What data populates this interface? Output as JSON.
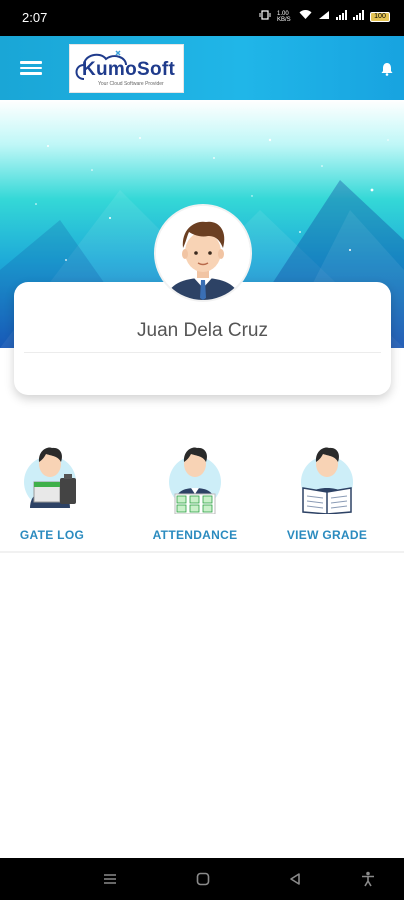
{
  "status_bar": {
    "time": "2:07",
    "network_speed": "1.00 KB/S",
    "battery": "100",
    "icons": [
      "vibrate-icon",
      "wifi-icon",
      "volte-icon",
      "signal-icon",
      "signal-icon",
      "battery-icon"
    ]
  },
  "app_bar": {
    "logo_text": "KumoSoft",
    "logo_tagline": "Your Cloud Software Provider",
    "icons": [
      "menu-icon",
      "bell-icon"
    ],
    "colors": {
      "primary": "#1aa6d6"
    }
  },
  "profile": {
    "name": "Juan Dela Cruz"
  },
  "actions": [
    {
      "label": "GATE LOG",
      "icon": "gate-log-icon"
    },
    {
      "label": "ATTENDANCE",
      "icon": "attendance-icon"
    },
    {
      "label": "VIEW GRADE",
      "icon": "view-grade-icon"
    }
  ],
  "nav_bar": {
    "icons": [
      "recents-icon",
      "home-icon",
      "back-icon",
      "accessibility-icon"
    ]
  }
}
